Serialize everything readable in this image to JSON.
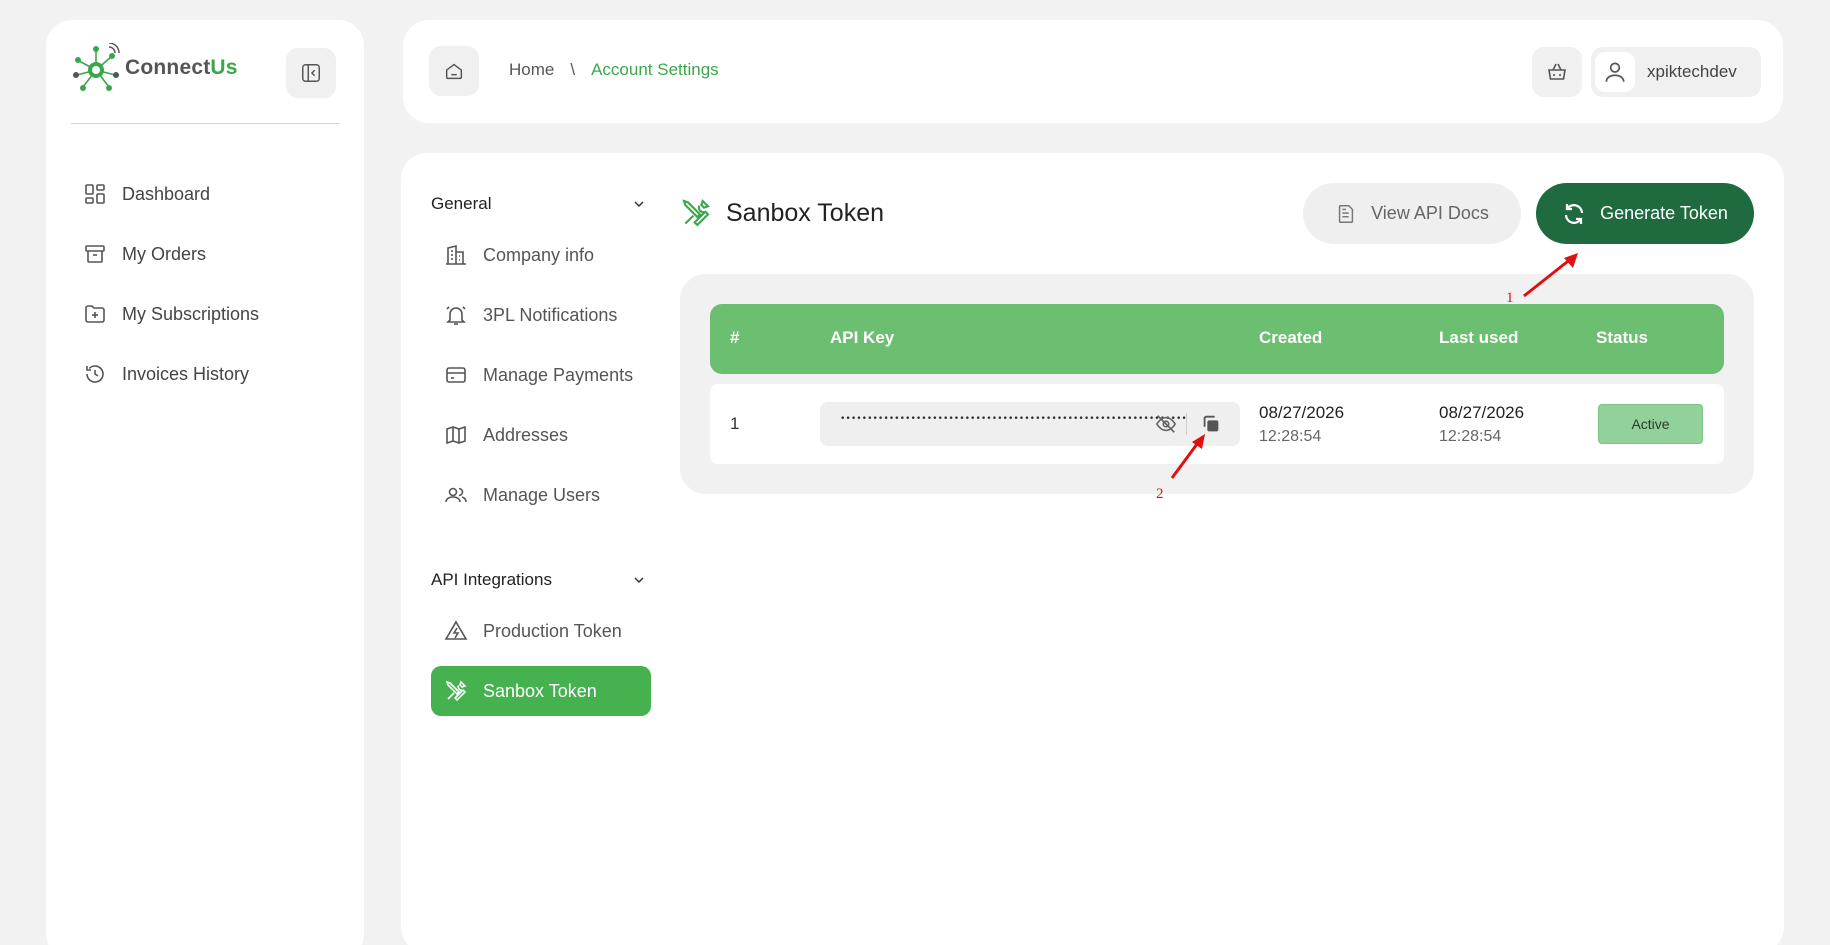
{
  "brand": {
    "name_part1": "Connect",
    "name_part2": "Us"
  },
  "sidebar": {
    "items": [
      {
        "label": "Dashboard",
        "icon": "dashboard-icon"
      },
      {
        "label": "My Orders",
        "icon": "archive-box-icon"
      },
      {
        "label": "My Subscriptions",
        "icon": "folder-plus-icon"
      },
      {
        "label": "Invoices History",
        "icon": "history-clock-icon"
      }
    ]
  },
  "header": {
    "breadcrumb": {
      "home": "Home",
      "separator": "\\",
      "current": "Account Settings"
    },
    "username": "xpiktechdev"
  },
  "settings_nav": {
    "general": {
      "title": "General",
      "items": [
        {
          "label": "Company info",
          "icon": "building-icon"
        },
        {
          "label": "3PL Notifications",
          "icon": "bell-icon"
        },
        {
          "label": "Manage Payments",
          "icon": "credit-card-icon"
        },
        {
          "label": "Addresses",
          "icon": "map-icon"
        },
        {
          "label": "Manage Users",
          "icon": "users-icon"
        }
      ]
    },
    "api": {
      "title": "API Integrations",
      "items": [
        {
          "label": "Production Token",
          "icon": "lightning-warning-icon"
        },
        {
          "label": "Sanbox Token",
          "icon": "tools-icon",
          "active": true
        }
      ]
    }
  },
  "page": {
    "title": "Sanbox Token",
    "view_docs_label": "View API Docs",
    "generate_label": "Generate Token"
  },
  "table": {
    "headers": {
      "idx": "#",
      "key": "API Key",
      "created": "Created",
      "last_used": "Last used",
      "status": "Status"
    },
    "rows": [
      {
        "idx": "1",
        "key_masked": "••••••••••••••••••••••••••••••••••••••••••••••••••••••••••••••••",
        "created_date": "08/27/2026",
        "created_time": "12:28:54",
        "used_date": "08/27/2026",
        "used_time": "12:28:54",
        "status": "Active"
      }
    ]
  },
  "annotations": {
    "a1": "1",
    "a2": "2"
  },
  "colors": {
    "accent": "#46b14f",
    "dark_green": "#1f6b3f",
    "table_head": "#6cbf71",
    "badge": "#93d19a",
    "annotation": "#e01010"
  }
}
